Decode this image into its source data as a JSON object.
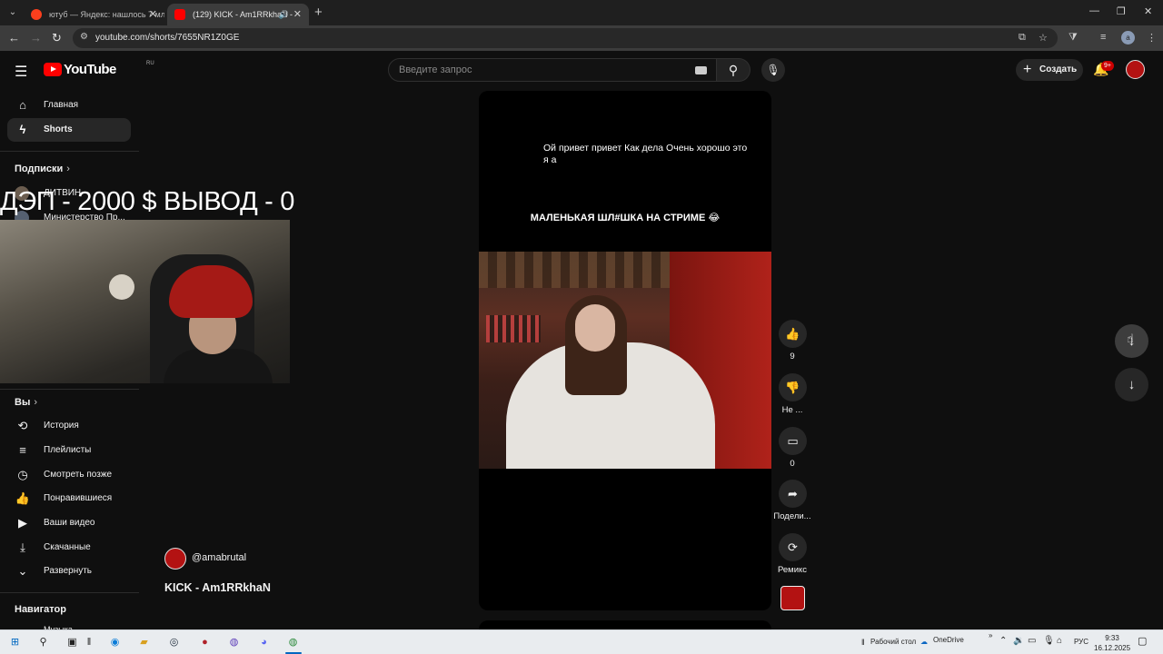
{
  "browser": {
    "tabs": [
      {
        "title": "ютуб — Яндекс: нашлось 7 млн",
        "active": false
      },
      {
        "title": "(129) KICK - Am1RRkhaN -",
        "active": true
      }
    ],
    "url": "youtube.com/shorts/7655NR1Z0GE"
  },
  "masthead": {
    "logo_text": "YouTube",
    "region": "RU",
    "search_placeholder": "Введите запрос",
    "create_label": "Создать",
    "notifications_badge": "9+"
  },
  "sidebar": {
    "top_items": [
      {
        "label": "Главная",
        "icon": "home-icon"
      },
      {
        "label": "Shorts",
        "icon": "shorts-icon"
      }
    ],
    "subscriptions_heading": "Подписки",
    "subscriptions": [
      {
        "label": "ДИТВИН"
      },
      {
        "label": "Министерство Пр..."
      }
    ],
    "you_heading": "Вы",
    "you_items": [
      {
        "label": "История",
        "icon": "history-icon"
      },
      {
        "label": "Плейлисты",
        "icon": "playlists-icon"
      },
      {
        "label": "Смотреть позже",
        "icon": "watch-later-icon"
      },
      {
        "label": "Понравившиеся",
        "icon": "like-icon"
      },
      {
        "label": "Ваши видео",
        "icon": "your-videos-icon"
      },
      {
        "label": "Скачанные",
        "icon": "download-icon"
      },
      {
        "label": "Развернуть",
        "icon": "chevron-down-icon"
      }
    ],
    "navigator_heading": "Навигатор",
    "navigator_partial": "Музыка"
  },
  "overlay": {
    "stream_text": "ДЭП - 2000 $ ВЫВОД - 0"
  },
  "short": {
    "caption_top": "Ой привет привет Как дела Очень хорошо это я а",
    "caption_main": "МАЛЕНЬКАЯ ШЛ#ШКА НА СТРИМЕ 😂",
    "channel_handle": "@amabrutal",
    "title": "KICK - Am1RRkhaN",
    "actions": {
      "like_count": "9",
      "dislike_label": "Не ...",
      "comments_count": "0",
      "share_label": "Подели...",
      "remix_label": "Ремикс"
    }
  },
  "taskbar": {
    "desktop_label": "Рабочий стол",
    "onedrive_label": "OneDrive",
    "lang": "РУС",
    "time": "9:33",
    "date": "16.12.2025"
  }
}
